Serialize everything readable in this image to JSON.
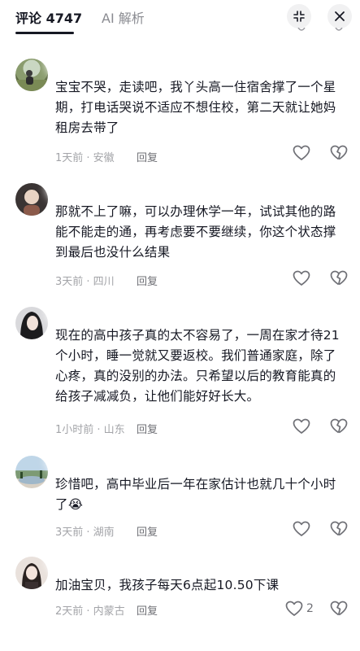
{
  "header": {
    "comments_tab": "评论 4747",
    "ai_tab": "AI 解析"
  },
  "comments": [
    {
      "text": "宝宝不哭，走读吧，我丫头高一住宿舍撑了一个星期，打电话哭说不适应不想住校，第二天就让她妈租房去带了",
      "time_location": "1天前 · 安徽",
      "reply": "回复",
      "like_count": ""
    },
    {
      "text": "那就不上了嘛，可以办理休学一年，试试其他的路能不能走的通，再考虑要不要继续，你这个状态撑到最后也没什么结果",
      "time_location": "3天前 · 四川",
      "reply": "回复",
      "like_count": ""
    },
    {
      "text": "现在的高中孩子真的太不容易了，一周在家才待21个小时，睡一觉就又要返校。我们普通家庭，除了心疼，真的没别的办法。只希望以后的教育能真的给孩子减减负，让他们能好好长大。",
      "time_location": "1小时前 · 山东",
      "reply": "回复",
      "like_count": ""
    },
    {
      "text": "珍惜吧，高中毕业后一年在家估计也就几十个小时了😭",
      "time_location": "3天前 · 湖南",
      "reply": "回复",
      "like_count": ""
    },
    {
      "text": "加油宝贝，我孩子每天6点起10.50下课",
      "time_location": "2天前 · 内蒙古",
      "reply": "回复",
      "like_count": "2"
    }
  ],
  "icons": {
    "expand": "collapse-arrows-icon",
    "close": "close-icon",
    "like": "heart-outline-icon",
    "dislike": "broken-heart-outline-icon"
  },
  "colors": {
    "text": "#161823",
    "meta": "#a3a4a8",
    "button_bg": "#f1f1f2"
  }
}
